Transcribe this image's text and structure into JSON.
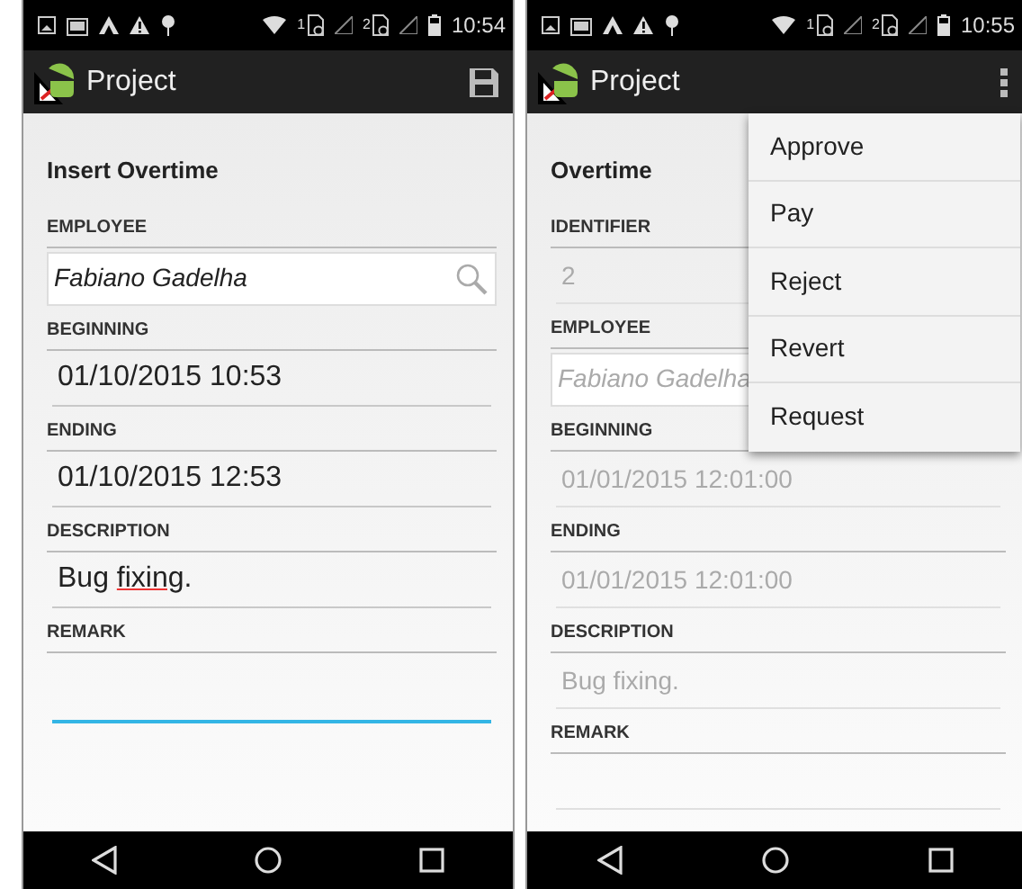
{
  "screens": [
    {
      "status_bar": {
        "sims": [
          "1",
          "2"
        ],
        "time": "10:54"
      },
      "app_bar": {
        "title": "Project",
        "actions": [
          {
            "kind": "save"
          }
        ]
      },
      "form": {
        "title": "Insert Overtime",
        "fields": [
          {
            "label": "EMPLOYEE",
            "kind": "search",
            "disabled": false,
            "value_parts": [
              {
                "text": "Fabiano Gadelha",
                "misspelled": false
              }
            ]
          },
          {
            "label": "BEGINNING",
            "kind": "text",
            "disabled": false,
            "focused": false,
            "value_parts": [
              {
                "text": "01/10/2015 10:53",
                "misspelled": false
              }
            ]
          },
          {
            "label": "ENDING",
            "kind": "text",
            "disabled": false,
            "focused": false,
            "value_parts": [
              {
                "text": "01/10/2015 12:53",
                "misspelled": false
              }
            ]
          },
          {
            "label": "DESCRIPTION",
            "kind": "text",
            "disabled": false,
            "focused": false,
            "value_parts": [
              {
                "text": "Bug ",
                "misspelled": false
              },
              {
                "text": "fixing",
                "misspelled": true
              },
              {
                "text": ".",
                "misspelled": false
              }
            ]
          },
          {
            "label": "REMARK",
            "kind": "text",
            "disabled": false,
            "focused": true
          }
        ]
      }
    },
    {
      "status_bar": {
        "sims": [
          "1",
          "2"
        ],
        "time": "10:55"
      },
      "app_bar": {
        "title": "Project",
        "actions": [
          {
            "kind": "overflow"
          }
        ]
      },
      "form": {
        "title": "Overtime",
        "fields": [
          {
            "label": "IDENTIFIER",
            "kind": "text",
            "disabled": true,
            "focused": false,
            "value_parts": [
              {
                "text": "2",
                "misspelled": false
              }
            ]
          },
          {
            "label": "EMPLOYEE",
            "kind": "search",
            "disabled": true,
            "value_parts": [
              {
                "text": "Fabiano Gadelha",
                "misspelled": false
              }
            ]
          },
          {
            "label": "BEGINNING",
            "kind": "text",
            "disabled": true,
            "focused": false,
            "value_parts": [
              {
                "text": "01/01/2015 12:01:00",
                "misspelled": false
              }
            ]
          },
          {
            "label": "ENDING",
            "kind": "text",
            "disabled": true,
            "focused": false,
            "value_parts": [
              {
                "text": "01/01/2015 12:01:00",
                "misspelled": false
              }
            ]
          },
          {
            "label": "DESCRIPTION",
            "kind": "text",
            "disabled": true,
            "focused": false,
            "value_parts": [
              {
                "text": "Bug fixing.",
                "misspelled": false
              }
            ]
          },
          {
            "label": "REMARK",
            "kind": "text",
            "disabled": true,
            "focused": false
          }
        ]
      },
      "menu": {
        "items": [
          "Approve",
          "Pay",
          "Reject",
          "Revert",
          "Request"
        ]
      }
    }
  ]
}
